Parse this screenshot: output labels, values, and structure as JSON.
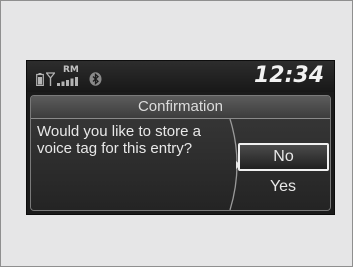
{
  "status_bar": {
    "roaming_label": "RM",
    "clock": "12:34",
    "icons": [
      "battery-icon",
      "antenna-icon",
      "signal-bars-icon",
      "bluetooth-icon"
    ]
  },
  "dialog": {
    "title": "Confirmation",
    "message": "Would you like to store a voice tag for this entry?",
    "options": [
      {
        "label": "No",
        "selected": true
      },
      {
        "label": "Yes",
        "selected": false
      }
    ]
  },
  "colors": {
    "screen_background": "#1b1b1b",
    "text": "#e8e8e8",
    "highlight_border": "#f0f0f0"
  }
}
